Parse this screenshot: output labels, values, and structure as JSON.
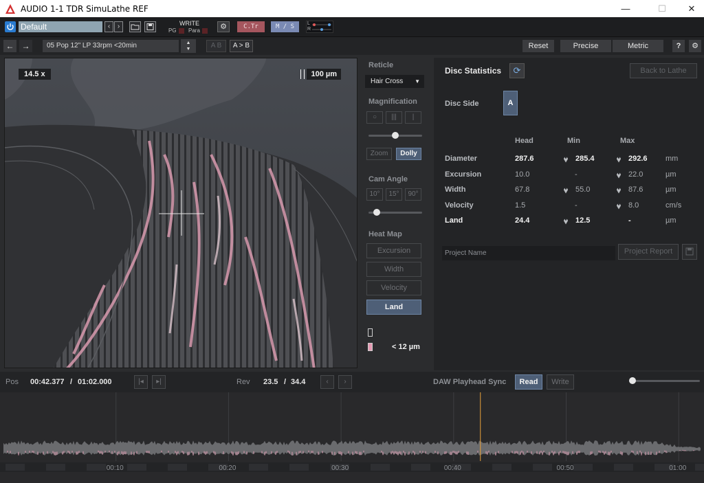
{
  "window": {
    "title": "AUDIO 1-1 TDR SimuLathe REF",
    "minimize": "—",
    "maximize": "☐",
    "close": "✕"
  },
  "toolbar": {
    "preset": "Default",
    "write_label": "WRITE",
    "pg_label": "PG",
    "para_label": "Para",
    "ctr_label": "C.Tr",
    "ms_label": "M / S",
    "l_label": "L",
    "r_label": "R"
  },
  "toolbar2": {
    "track": "05 Pop 12\" LP 33rpm <20min",
    "ab_label": "A B",
    "a_to_b_label": "A > B",
    "reset_label": "Reset",
    "precise_label": "Precise",
    "metric_label": "Metric",
    "help_label": "?"
  },
  "viewer": {
    "zoom": "14.5 x",
    "scale": "100 µm"
  },
  "controls": {
    "reticle_label": "Reticle",
    "reticle_value": "Hair Cross",
    "magnification_label": "Magnification",
    "mag_slider": 0.5,
    "zoom_label": "Zoom",
    "dolly_label": "Dolly",
    "cam_angle_label": "Cam Angle",
    "angle_10": "10°",
    "angle_15": "15°",
    "angle_90": "90°",
    "cam_slider": 0.1,
    "heat_map_label": "Heat Map",
    "hm_excursion": "Excursion",
    "hm_width": "Width",
    "hm_velocity": "Velocity",
    "hm_land": "Land",
    "legend_value": "< 12 µm",
    "legend_color": "#e59ab2"
  },
  "stats": {
    "title": "Disc Statistics",
    "back_label": "Back to Lathe",
    "disc_side_label": "Disc Side",
    "disc_side_value": "A",
    "headers": {
      "head": "Head",
      "min": "Min",
      "max": "Max"
    },
    "rows": [
      {
        "name": "Diameter",
        "head": "287.6",
        "min": "285.4",
        "max": "292.6",
        "unit": "mm"
      },
      {
        "name": "Excursion",
        "head": "10.0",
        "min": "-",
        "max": "22.0",
        "unit": "µm"
      },
      {
        "name": "Width",
        "head": "67.8",
        "min": "55.0",
        "max": "87.6",
        "unit": "µm"
      },
      {
        "name": "Velocity",
        "head": "1.5",
        "min": "-",
        "max": "8.0",
        "unit": "cm/s"
      },
      {
        "name": "Land",
        "head": "24.4",
        "min": "12.5",
        "max": "-",
        "unit": "µm"
      }
    ],
    "project_placeholder": "Project Name",
    "report_label": "Project Report"
  },
  "transport": {
    "pos_label": "Pos",
    "pos_current": "00:42.377",
    "pos_total": "01:02.000",
    "rev_label": "Rev",
    "rev_current": "23.5",
    "rev_total": "34.4",
    "sync_label": "DAW Playhead Sync",
    "read_label": "Read",
    "write_label": "Write",
    "sep": "/",
    "zoom_slider": 0.0
  },
  "timeline": {
    "ticks": [
      "00:10",
      "00:20",
      "00:30",
      "00:40",
      "00:50",
      "01:00"
    ],
    "duration_seconds": 62,
    "playhead_seconds": 42.377
  }
}
